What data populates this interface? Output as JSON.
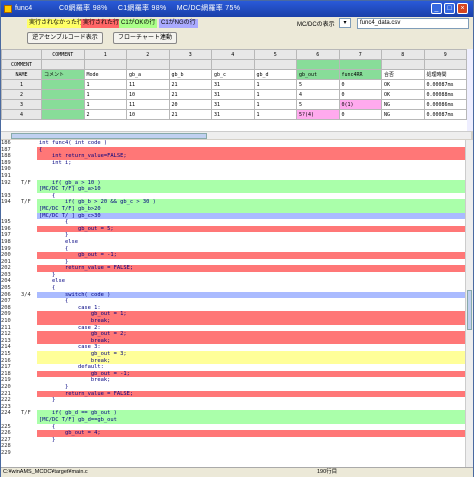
{
  "window": {
    "title": "func4",
    "stats": [
      "C0網羅率 98%",
      "C1網羅率 98%",
      "MC/DC網羅率 75%"
    ]
  },
  "toolbar": {
    "legend": [
      "実行されなかった行",
      "実行された行",
      "C1がOKの行",
      "C1がNGの行"
    ],
    "view_label": "MC/DCの表示",
    "file": "func4_data.csv",
    "asm_button": "逆アセンブルコード表示",
    "flow_button": "フローチャート連動"
  },
  "grid": {
    "headers": [
      "",
      "COMMENT",
      "1",
      "2",
      "3",
      "4",
      "5",
      "6",
      "7",
      "8",
      "9"
    ],
    "rows": [
      [
        "COMMENT",
        "",
        "",
        "",
        "",
        "",
        "",
        "",
        "",
        "",
        ""
      ],
      [
        "NAME",
        "コメント",
        "Mode",
        "gb_a",
        "gb_b",
        "gb_c",
        "gb_d",
        "gb_out",
        "func4RR",
        "合否",
        "処理時間"
      ],
      [
        "1",
        "",
        "1",
        "11",
        "21",
        "31",
        "1",
        "5",
        "0",
        "OK",
        "0.00087ms"
      ],
      [
        "2",
        "",
        "1",
        "10",
        "21",
        "31",
        "1",
        "4",
        "0",
        "OK",
        "0.00088ms"
      ],
      [
        "3",
        "",
        "1",
        "11",
        "20",
        "31",
        "1",
        "5",
        "0(1)",
        "NG",
        "0.00086ms"
      ],
      [
        "4",
        "",
        "2",
        "10",
        "21",
        "31",
        "1",
        "5?(4)",
        "0",
        "NG",
        "0.00087ms"
      ]
    ]
  },
  "code": [
    {
      "n": "186",
      "c": "",
      "t": "int func4( int code )",
      "k": ""
    },
    {
      "n": "187",
      "c": "",
      "t": "{",
      "k": "r"
    },
    {
      "n": "188",
      "c": "",
      "t": "    int return_value=FALSE;",
      "k": "r"
    },
    {
      "n": "189",
      "c": "",
      "t": "    int i;",
      "k": ""
    },
    {
      "n": "190",
      "c": "",
      "t": "",
      "k": ""
    },
    {
      "n": "191",
      "c": "",
      "t": "",
      "k": ""
    },
    {
      "n": "192",
      "c": "T/F",
      "t": "    if( gb_a > 10 )",
      "k": "g"
    },
    {
      "n": "",
      "c": "",
      "t": "[MC/DC T/F] gb_a>10",
      "k": "g"
    },
    {
      "n": "193",
      "c": "",
      "t": "    {",
      "k": ""
    },
    {
      "n": "194",
      "c": "T/F",
      "t": "        if( gb_b > 20 && gb_c > 30 )",
      "k": "g"
    },
    {
      "n": "",
      "c": "",
      "t": "[MC/DC T/F] gb_b>20",
      "k": "g"
    },
    {
      "n": "",
      "c": "",
      "t": "[MC/DC T/ ] gb_c>30",
      "k": "b"
    },
    {
      "n": "195",
      "c": "",
      "t": "        {",
      "k": ""
    },
    {
      "n": "196",
      "c": "",
      "t": "            gb_out = 5;",
      "k": "r"
    },
    {
      "n": "197",
      "c": "",
      "t": "        }",
      "k": ""
    },
    {
      "n": "198",
      "c": "",
      "t": "        else",
      "k": ""
    },
    {
      "n": "199",
      "c": "",
      "t": "        {",
      "k": ""
    },
    {
      "n": "200",
      "c": "",
      "t": "            gb_out = -1;",
      "k": "r"
    },
    {
      "n": "201",
      "c": "",
      "t": "        }",
      "k": ""
    },
    {
      "n": "202",
      "c": "",
      "t": "        return_value = FALSE;",
      "k": "r"
    },
    {
      "n": "203",
      "c": "",
      "t": "    }",
      "k": ""
    },
    {
      "n": "204",
      "c": "",
      "t": "    else",
      "k": ""
    },
    {
      "n": "205",
      "c": "",
      "t": "    {",
      "k": ""
    },
    {
      "n": "206",
      "c": "3/4",
      "t": "        switch( code )",
      "k": "b"
    },
    {
      "n": "207",
      "c": "",
      "t": "        {",
      "k": ""
    },
    {
      "n": "208",
      "c": "",
      "t": "            case 1:",
      "k": ""
    },
    {
      "n": "209",
      "c": "",
      "t": "                gb_out = 1;",
      "k": "r"
    },
    {
      "n": "210",
      "c": "",
      "t": "                break;",
      "k": "r"
    },
    {
      "n": "211",
      "c": "",
      "t": "            case 2:",
      "k": ""
    },
    {
      "n": "212",
      "c": "",
      "t": "                gb_out = 2;",
      "k": "r"
    },
    {
      "n": "213",
      "c": "",
      "t": "                break;",
      "k": "r"
    },
    {
      "n": "214",
      "c": "",
      "t": "            case 3:",
      "k": ""
    },
    {
      "n": "215",
      "c": "",
      "t": "                gb_out = 3;",
      "k": "y"
    },
    {
      "n": "216",
      "c": "",
      "t": "                break;",
      "k": "y"
    },
    {
      "n": "217",
      "c": "",
      "t": "            default:",
      "k": ""
    },
    {
      "n": "218",
      "c": "",
      "t": "                gb_out = -1;",
      "k": "r"
    },
    {
      "n": "219",
      "c": "",
      "t": "                break;",
      "k": ""
    },
    {
      "n": "220",
      "c": "",
      "t": "        }",
      "k": ""
    },
    {
      "n": "221",
      "c": "",
      "t": "        return_value = FALSE;",
      "k": "r"
    },
    {
      "n": "222",
      "c": "",
      "t": "    }",
      "k": ""
    },
    {
      "n": "223",
      "c": "",
      "t": "",
      "k": ""
    },
    {
      "n": "224",
      "c": "T/F",
      "t": "    if( gb_d == gb_out )",
      "k": "g"
    },
    {
      "n": "",
      "c": "",
      "t": "[MC/DC T/F] gb_d==gb_out",
      "k": "g"
    },
    {
      "n": "225",
      "c": "",
      "t": "    {",
      "k": ""
    },
    {
      "n": "226",
      "c": "",
      "t": "        gb_out = 4;",
      "k": "r"
    },
    {
      "n": "227",
      "c": "",
      "t": "    }",
      "k": ""
    },
    {
      "n": "228",
      "c": "",
      "t": "",
      "k": ""
    },
    {
      "n": "229",
      "c": "",
      "t": "",
      "k": ""
    }
  ],
  "status": {
    "path": "C:¥winAMS_MCDC¥target¥main.c",
    "line": "190行目"
  }
}
